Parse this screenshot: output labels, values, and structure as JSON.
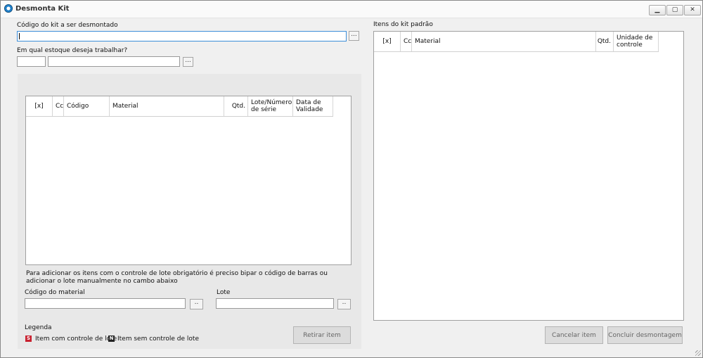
{
  "window": {
    "title": "Desmonta Kit",
    "controls": {
      "minimize": "▁",
      "maximize": "▢",
      "close": "✕"
    }
  },
  "kit": {
    "code_label": "Código do kit a ser desmontado",
    "code_value": "",
    "browse": "..."
  },
  "stock": {
    "label": "Em qual estoque deseja trabalhar?",
    "code_value": "",
    "name_value": "",
    "browse": "..."
  },
  "items_grid": {
    "columns": [
      "[x]",
      "Cc",
      "Código",
      "Material",
      "Qtd.",
      "Lote/Número de série",
      "Data de Validade"
    ]
  },
  "instruction": "Para adicionar os itens com o controle de lote obrigatório é preciso bipar o código de barras ou adicionar o lote manualmente no cambo abaixo",
  "material": {
    "label": "Código do material",
    "value": "",
    "browse": ".."
  },
  "lot": {
    "label": "Lote",
    "value": "",
    "browse": ".."
  },
  "legend": {
    "title": "Legenda",
    "items": [
      {
        "badge": "S",
        "color": "#c8202f",
        "label": "Item com controle de lote"
      },
      {
        "badge": "N",
        "color": "#222222",
        "label": "Item sem controle de lote"
      }
    ]
  },
  "buttons": {
    "remove_item": "Retirar item",
    "cancel_item": "Cancelar item",
    "finish": "Concluir desmontagem"
  },
  "kit_grid": {
    "title": "Itens do kit padrão",
    "columns": [
      "[x]",
      "Cc",
      "Material",
      "Qtd.",
      "Unidade de controle"
    ]
  },
  "colors": {
    "focus_border": "#3c8ed9",
    "window_bg": "#f0f0f0",
    "panel_bg": "#e8e8e8"
  }
}
